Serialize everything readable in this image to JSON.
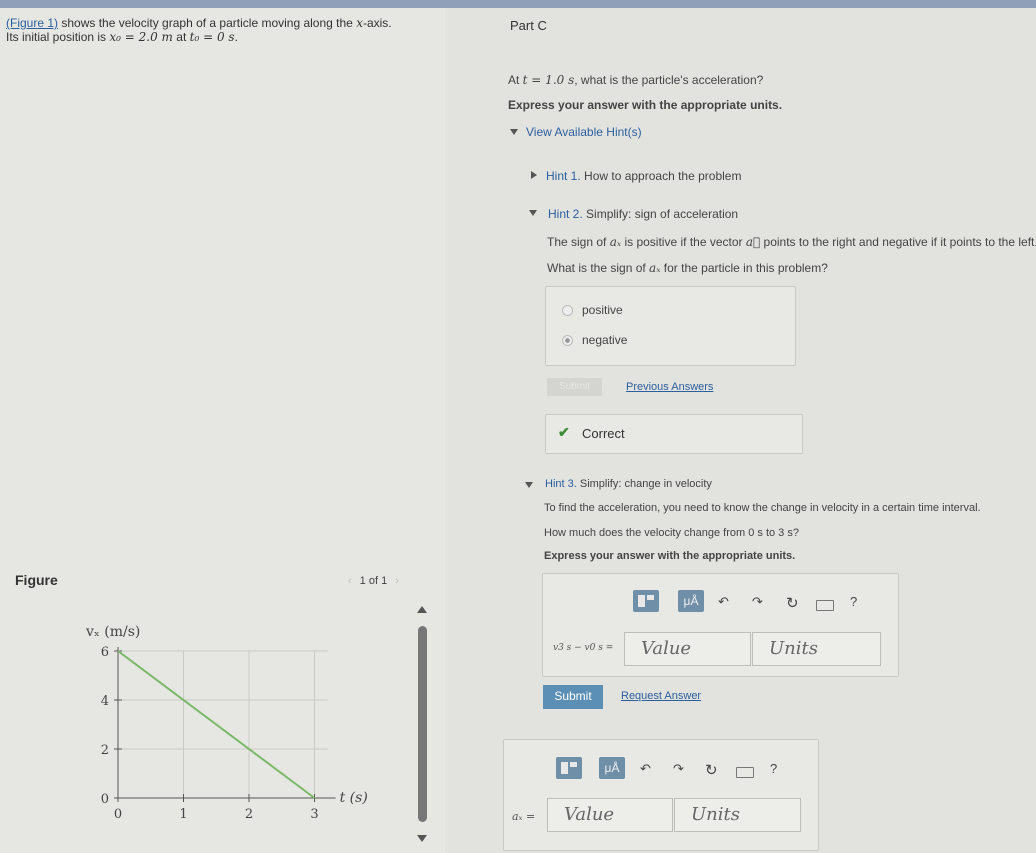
{
  "intro": {
    "figure_link": "(Figure 1)",
    "line1_rest": " shows the velocity graph of a particle moving along the ",
    "axis_var": "x",
    "line1_end": "-axis.",
    "line2_prefix": "Its initial position is ",
    "x0_expr": "x₀ = 2.0 m",
    "at_word": " at ",
    "t0_expr": "t₀ = 0 s",
    "line2_end": "."
  },
  "figure": {
    "label": "Figure",
    "pager_text": "1 of 1"
  },
  "part": {
    "title": "Part C",
    "question_prefix": "At ",
    "question_t": "t = 1.0 s",
    "question_suffix": ", what is the particle's acceleration?",
    "instruction": "Express your answer with the appropriate units.",
    "view_hints": "View Available Hint(s)"
  },
  "hint1": {
    "label": "Hint 1.",
    "title": "How to approach the problem"
  },
  "hint2": {
    "label": "Hint 2.",
    "title": "Simplify: sign of acceleration",
    "text_prefix": "The sign of ",
    "ax": "aₓ",
    "text_mid": " is positive if the vector ",
    "vec_a": "a⃗",
    "text_suffix": " points to the right and negative if it points to the left.",
    "question_prefix": "What is the sign of ",
    "question_suffix": " for the particle in this problem?",
    "options": [
      "positive",
      "negative"
    ],
    "selected_option": "negative",
    "submit_label": "Submit",
    "previous_answers": "Previous Answers",
    "feedback": "Correct"
  },
  "hint3": {
    "label": "Hint 3.",
    "title": "Simplify: change in velocity",
    "text": "To find the acceleration, you need to know the change in velocity in a certain time interval.",
    "question": "How much does the velocity change from 0 s to 3 s?",
    "instruction": "Express your answer with the appropriate units.",
    "answer_label": "v3 s − v0 s =",
    "value_placeholder": "Value",
    "units_placeholder": "Units",
    "submit_label": "Submit",
    "request_answer": "Request Answer"
  },
  "main_answer": {
    "label": "aₓ =",
    "value_placeholder": "Value",
    "units_placeholder": "Units"
  },
  "toolbar": {
    "mu_label": "μÅ",
    "undo": "↶",
    "redo": "↷",
    "reset": "↻",
    "help": "?"
  },
  "colors": {
    "accent_blue": "#5b8fb6",
    "line_green": "#7cb86a",
    "correct_green": "#3a8b3a",
    "link_blue": "#2c5f9e"
  },
  "chart_data": {
    "type": "line",
    "ylabel": "vₓ (m/s)",
    "xlabel": "t (s)",
    "x_ticks": [
      "0",
      "1",
      "2",
      "3"
    ],
    "y_ticks": [
      "0",
      "2",
      "4",
      "6"
    ],
    "xlim": [
      0,
      3.2
    ],
    "ylim": [
      0,
      6
    ],
    "grid": true,
    "series": [
      {
        "x": [
          0,
          3
        ],
        "y": [
          6,
          0
        ]
      }
    ]
  }
}
